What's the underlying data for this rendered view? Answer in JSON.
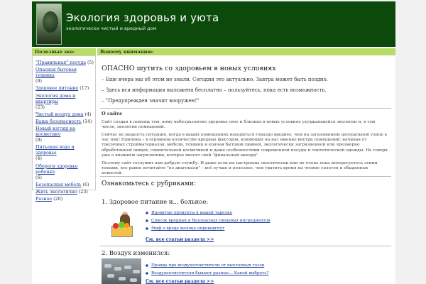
{
  "header": {
    "title": "Экология здоровья и уюта",
    "subtitle": "экологически чистый и вредный дом"
  },
  "bars": {
    "left": "Полезные эко-советы:",
    "right": "Вашему вниманию:"
  },
  "sidebar": {
    "items": [
      {
        "label": "\"Правильная\" посуда",
        "count": " (5)"
      },
      {
        "label": "Опасная бытовая техника",
        "count": " (9)"
      },
      {
        "label": "Здоровое питание",
        "count": " (17)"
      },
      {
        "label": "Экология дома и квартиры",
        "count": " (23)"
      },
      {
        "label": "Чистый воздух дома",
        "count": " (4)"
      },
      {
        "label": "Ваша безопасность",
        "count": " (14)"
      },
      {
        "label": "Новый взгляд на косметику",
        "count": " (9)"
      },
      {
        "label": "Питьевая вода и здоровье",
        "count": " (4)"
      },
      {
        "label": "Обереги здоровье ребенка",
        "count": " (6)"
      },
      {
        "label": "Безопасная мебель",
        "count": " (6)"
      },
      {
        "label": "Жить экологично",
        "count": " (23)"
      },
      {
        "label": "Разное",
        "count": " (20)"
      }
    ]
  },
  "intro": {
    "title": "ОПАСНО шутить со здоровьем в новых условиях",
    "lines": [
      "– Еще вчера мы об этом не знали. Сегодня это актуально. Завтра может быть поздно.",
      "– Здесь вся информация выложена бесплатно – пользуйтесь, пока есть возможность.",
      "– \"Предупрежден значит вооружен!\""
    ]
  },
  "about": {
    "title": "О сайте",
    "paragraphs": [
      "Сайт создан в помощь тем, кому небезразлично здоровье свое и близких в новых условиях ухудшающейся экологии и, в том числе, экологии помещений.",
      "Сейчас не редкость ситуация, когда в ваших помещениях находиться гораздо вреднее, чем на загазованной центральной улице в час пик! Причина – в огромном количестве вредных факторов, влияющих на нас именно внутри помещений: начиная от токсичных стройматериалов, мебели, техники и кончая бытовой химией, экологически загрязненной или чрезмерно обработанной пищей, сомнительной косметикой и даже особенностями современной посуды и синтетической одежды. Не говоря уже о внешнем загрязнении, которое вносят свой \"финальный аккорд\".",
      "Поэтому сайт сослужит вам добрую службу. И даже если вы настроены скептически или не очень пока интересуетесь этими темами, все равно почитайте \"по диагонали\" – всё лучше и полезнее, чем тратить время на чтение сплетен и обыденных новостей."
    ]
  },
  "rubrics": {
    "title": "Ознакомьтесь с рубриками:",
    "sections": [
      {
        "title": "1. Здоровое питание и... больное:",
        "links": [
          "Ядовитые продукты в вашей тарелке",
          "Список вредных и безопасных пищевых ингредиентов",
          "Миф о вреде молока опровергнут"
        ],
        "see_all": "См. все статьи раздела >>"
      },
      {
        "title": "2. Воздух изменился:",
        "links": [
          "Правда про воздухоочистители от выхлопных газов",
          "Воздухоочистители бывают разные... Какой выбрать?"
        ],
        "see_all": "См. все статьи раздела >>"
      }
    ]
  },
  "colors": {
    "header_bg": "#0b4a0b",
    "bar_bg": "#b9dc66",
    "link": "#1a3a9a"
  },
  "icons": [
    "tree-photo-icon",
    "food-shopper-image",
    "traffic-jam-image"
  ]
}
